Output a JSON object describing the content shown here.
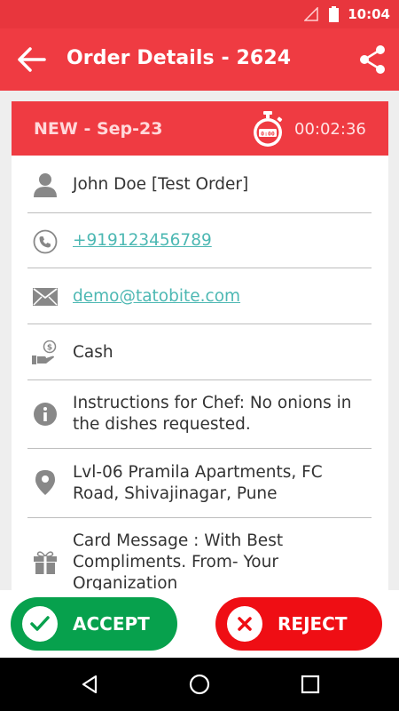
{
  "status_bar": {
    "time": "10:04"
  },
  "app_bar": {
    "title": "Order Details - 2624"
  },
  "order": {
    "status": "NEW - Sep-23",
    "timer": "00:02:36",
    "customer_name": "John Doe [Test Order]",
    "phone": "+919123456789",
    "email": "demo@tatobite.com",
    "payment": "Cash",
    "instructions": "Instructions for Chef: No onions in the dishes requested.",
    "address": "Lvl-06 Pramila Apartments, FC Road, Shivajinagar, Pune",
    "card_message": "Card Message : With Best Compliments. From- Your Organization"
  },
  "actions": {
    "accept_label": "ACCEPT",
    "reject_label": "REJECT"
  },
  "colors": {
    "primary": "#ef3b42",
    "accept": "#07a14d",
    "reject": "#ef0e14",
    "link": "#4db8b3"
  }
}
